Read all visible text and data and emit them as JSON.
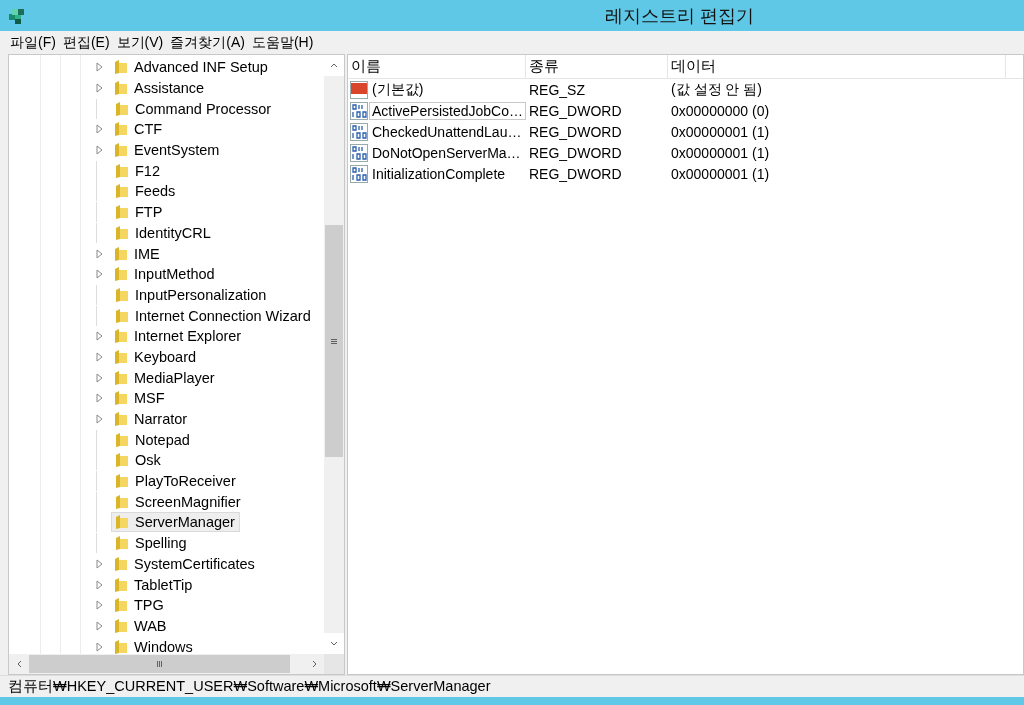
{
  "window": {
    "title": "레지스트리 편집기"
  },
  "menu": [
    "파일(F)",
    "편집(E)",
    "보기(V)",
    "즐겨찾기(A)",
    "도움말(H)"
  ],
  "tree": {
    "items": [
      {
        "label": "Advanced INF Setup",
        "expandable": true,
        "selected": false
      },
      {
        "label": "Assistance",
        "expandable": true,
        "selected": false
      },
      {
        "label": "Command Processor",
        "expandable": false,
        "selected": false
      },
      {
        "label": "CTF",
        "expandable": true,
        "selected": false
      },
      {
        "label": "EventSystem",
        "expandable": true,
        "selected": false
      },
      {
        "label": "F12",
        "expandable": false,
        "selected": false
      },
      {
        "label": "Feeds",
        "expandable": false,
        "selected": false
      },
      {
        "label": "FTP",
        "expandable": false,
        "selected": false
      },
      {
        "label": "IdentityCRL",
        "expandable": false,
        "selected": false
      },
      {
        "label": "IME",
        "expandable": true,
        "selected": false
      },
      {
        "label": "InputMethod",
        "expandable": true,
        "selected": false
      },
      {
        "label": "InputPersonalization",
        "expandable": false,
        "selected": false
      },
      {
        "label": "Internet Connection Wizard",
        "expandable": false,
        "selected": false
      },
      {
        "label": "Internet Explorer",
        "expandable": true,
        "selected": false
      },
      {
        "label": "Keyboard",
        "expandable": true,
        "selected": false
      },
      {
        "label": "MediaPlayer",
        "expandable": true,
        "selected": false
      },
      {
        "label": "MSF",
        "expandable": true,
        "selected": false
      },
      {
        "label": "Narrator",
        "expandable": true,
        "selected": false
      },
      {
        "label": "Notepad",
        "expandable": false,
        "selected": false
      },
      {
        "label": "Osk",
        "expandable": false,
        "selected": false
      },
      {
        "label": "PlayToReceiver",
        "expandable": false,
        "selected": false
      },
      {
        "label": "ScreenMagnifier",
        "expandable": false,
        "selected": false
      },
      {
        "label": "ServerManager",
        "expandable": false,
        "selected": true
      },
      {
        "label": "Spelling",
        "expandable": false,
        "selected": false
      },
      {
        "label": "SystemCertificates",
        "expandable": true,
        "selected": false
      },
      {
        "label": "TabletTip",
        "expandable": true,
        "selected": false
      },
      {
        "label": "TPG",
        "expandable": true,
        "selected": false
      },
      {
        "label": "WAB",
        "expandable": true,
        "selected": false
      },
      {
        "label": "Windows",
        "expandable": true,
        "selected": false
      }
    ]
  },
  "table": {
    "columns": [
      "이름",
      "종류",
      "데이터"
    ],
    "rows": [
      {
        "kind": "string",
        "name": "(기본값)",
        "type": "REG_SZ",
        "data": "(값 설정 안 됨)",
        "focused": false
      },
      {
        "kind": "dword",
        "name": "ActivePersistedJobCo…",
        "type": "REG_DWORD",
        "data": "0x00000000 (0)",
        "focused": true
      },
      {
        "kind": "dword",
        "name": "CheckedUnattendLau…",
        "type": "REG_DWORD",
        "data": "0x00000001 (1)",
        "focused": false
      },
      {
        "kind": "dword",
        "name": "DoNotOpenServerMa…",
        "type": "REG_DWORD",
        "data": "0x00000001 (1)",
        "focused": false
      },
      {
        "kind": "dword",
        "name": "InitializationComplete",
        "type": "REG_DWORD",
        "data": "0x00000001 (1)",
        "focused": false
      }
    ]
  },
  "status_bar": "컴퓨터₩HKEY_CURRENT_USER₩Software₩Microsoft₩ServerManager"
}
